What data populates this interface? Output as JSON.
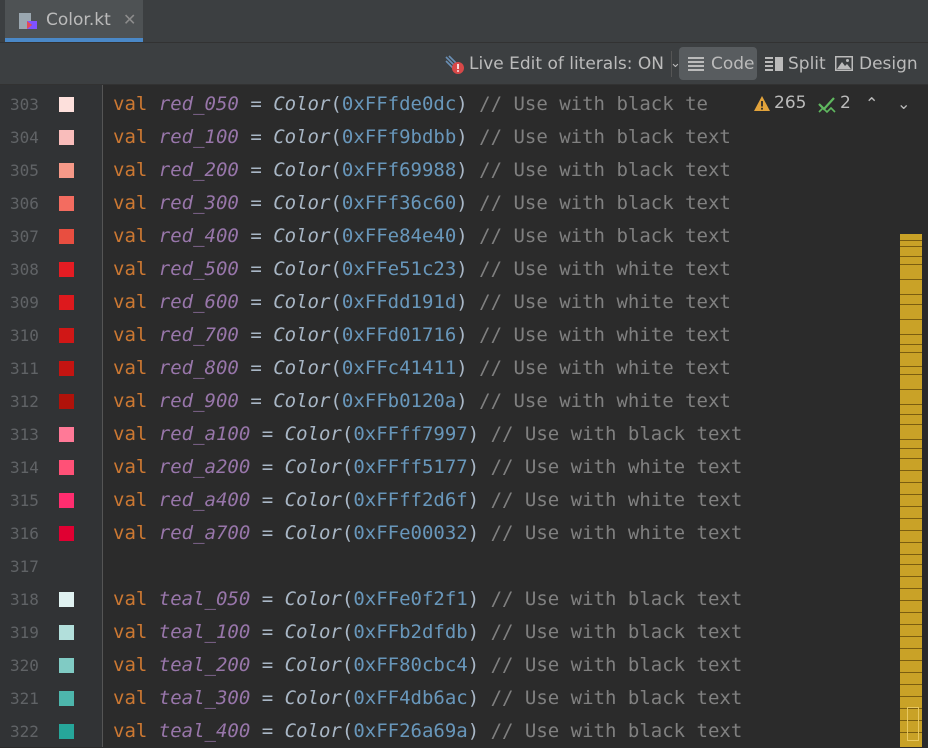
{
  "tab": {
    "title": "Color.kt",
    "close_glyph": "✕"
  },
  "toolbar": {
    "live_edit_label": "Live Edit of literals: ON",
    "live_edit_chevron": "⌄",
    "code_label": "Code",
    "split_label": "Split",
    "design_label": "Design"
  },
  "inspections": {
    "warnings": "265",
    "weak_warnings": "2",
    "up_glyph": "⌃",
    "down_glyph": "⌄"
  },
  "lines": [
    {
      "no": "303",
      "name": "red_050",
      "hex": "0xFFfde0dc",
      "comment": "// Use with black te",
      "swatch": "#fde0dc"
    },
    {
      "no": "304",
      "name": "red_100",
      "hex": "0xFFf9bdbb",
      "comment": "// Use with black text",
      "swatch": "#f9bdbb"
    },
    {
      "no": "305",
      "name": "red_200",
      "hex": "0xFFf69988",
      "comment": "// Use with black text",
      "swatch": "#f69988"
    },
    {
      "no": "306",
      "name": "red_300",
      "hex": "0xFFf36c60",
      "comment": "// Use with black text",
      "swatch": "#f36c60"
    },
    {
      "no": "307",
      "name": "red_400",
      "hex": "0xFFe84e40",
      "comment": "// Use with black text",
      "swatch": "#e84e40"
    },
    {
      "no": "308",
      "name": "red_500",
      "hex": "0xFFe51c23",
      "comment": "// Use with white text",
      "swatch": "#e51c23"
    },
    {
      "no": "309",
      "name": "red_600",
      "hex": "0xFFdd191d",
      "comment": "// Use with white text",
      "swatch": "#dd191d"
    },
    {
      "no": "310",
      "name": "red_700",
      "hex": "0xFFd01716",
      "comment": "// Use with white text",
      "swatch": "#d01716"
    },
    {
      "no": "311",
      "name": "red_800",
      "hex": "0xFFc41411",
      "comment": "// Use with white text",
      "swatch": "#c41411"
    },
    {
      "no": "312",
      "name": "red_900",
      "hex": "0xFFb0120a",
      "comment": "// Use with white text",
      "swatch": "#b0120a"
    },
    {
      "no": "313",
      "name": "red_a100",
      "hex": "0xFFff7997",
      "comment": "// Use with black text",
      "swatch": "#ff7997"
    },
    {
      "no": "314",
      "name": "red_a200",
      "hex": "0xFFff5177",
      "comment": "// Use with white text",
      "swatch": "#ff5177"
    },
    {
      "no": "315",
      "name": "red_a400",
      "hex": "0xFFff2d6f",
      "comment": "// Use with white text",
      "swatch": "#ff2d6f"
    },
    {
      "no": "316",
      "name": "red_a700",
      "hex": "0xFFe00032",
      "comment": "// Use with white text",
      "swatch": "#e00032"
    },
    {
      "no": "317",
      "name": "",
      "hex": "",
      "comment": "",
      "swatch": ""
    },
    {
      "no": "318",
      "name": "teal_050",
      "hex": "0xFFe0f2f1",
      "comment": "// Use with black text",
      "swatch": "#e0f2f1"
    },
    {
      "no": "319",
      "name": "teal_100",
      "hex": "0xFFb2dfdb",
      "comment": "// Use with black text",
      "swatch": "#b2dfdb"
    },
    {
      "no": "320",
      "name": "teal_200",
      "hex": "0xFF80cbc4",
      "comment": "// Use with black text",
      "swatch": "#80cbc4"
    },
    {
      "no": "321",
      "name": "teal_300",
      "hex": "0xFF4db6ac",
      "comment": "// Use with black text",
      "swatch": "#4db6ac"
    },
    {
      "no": "322",
      "name": "teal_400",
      "hex": "0xFF26a69a",
      "comment": "// Use with black text",
      "swatch": "#26a69a"
    }
  ],
  "syntax": {
    "keyword": "val",
    "eq": "=",
    "ctor": "Color",
    "open": "(",
    "close": ")"
  },
  "colors": {
    "keyword": "#cc7832",
    "identifier": "#9876aa",
    "number": "#6897bb",
    "comment": "#808080",
    "marker": "#c9a227"
  }
}
